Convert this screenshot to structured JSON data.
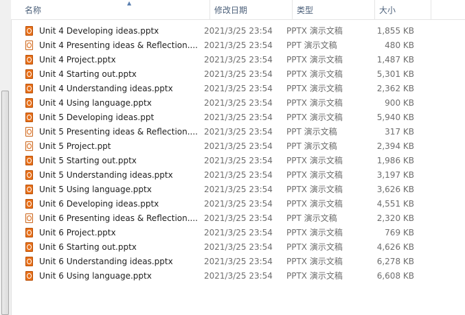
{
  "columns": {
    "name": "名称",
    "date": "修改日期",
    "type": "类型",
    "size": "大小"
  },
  "files": [
    {
      "name": "Unit 4 Developing ideas.pptx",
      "date": "2021/3/25 23:54",
      "type": "PPTX 演示文稿",
      "size": "1,855 KB",
      "icon": "pptx"
    },
    {
      "name": "Unit 4 Presenting ideas & Reflection....",
      "date": "2021/3/25 23:54",
      "type": "PPT 演示文稿",
      "size": "480 KB",
      "icon": "ppt"
    },
    {
      "name": "Unit 4 Project.pptx",
      "date": "2021/3/25 23:54",
      "type": "PPTX 演示文稿",
      "size": "1,487 KB",
      "icon": "pptx"
    },
    {
      "name": "Unit 4 Starting out.pptx",
      "date": "2021/3/25 23:54",
      "type": "PPTX 演示文稿",
      "size": "5,301 KB",
      "icon": "pptx"
    },
    {
      "name": "Unit 4 Understanding ideas.pptx",
      "date": "2021/3/25 23:54",
      "type": "PPTX 演示文稿",
      "size": "2,362 KB",
      "icon": "pptx"
    },
    {
      "name": "Unit 4 Using language.pptx",
      "date": "2021/3/25 23:54",
      "type": "PPTX 演示文稿",
      "size": "900 KB",
      "icon": "pptx"
    },
    {
      "name": "Unit 5 Developing ideas.ppt",
      "date": "2021/3/25 23:54",
      "type": "PPTX 演示文稿",
      "size": "5,940 KB",
      "icon": "pptx"
    },
    {
      "name": "Unit 5 Presenting ideas & Reflection....",
      "date": "2021/3/25 23:54",
      "type": "PPT 演示文稿",
      "size": "317 KB",
      "icon": "ppt"
    },
    {
      "name": "Unit 5 Project.ppt",
      "date": "2021/3/25 23:54",
      "type": "PPT 演示文稿",
      "size": "2,394 KB",
      "icon": "ppt"
    },
    {
      "name": "Unit 5 Starting out.pptx",
      "date": "2021/3/25 23:54",
      "type": "PPTX 演示文稿",
      "size": "1,986 KB",
      "icon": "pptx"
    },
    {
      "name": "Unit 5 Understanding ideas.pptx",
      "date": "2021/3/25 23:54",
      "type": "PPTX 演示文稿",
      "size": "3,197 KB",
      "icon": "pptx"
    },
    {
      "name": "Unit 5 Using language.pptx",
      "date": "2021/3/25 23:54",
      "type": "PPTX 演示文稿",
      "size": "3,626 KB",
      "icon": "pptx"
    },
    {
      "name": "Unit 6 Developing ideas.pptx",
      "date": "2021/3/25 23:54",
      "type": "PPTX 演示文稿",
      "size": "4,551 KB",
      "icon": "pptx"
    },
    {
      "name": "Unit 6 Presenting ideas & Reflection....",
      "date": "2021/3/25 23:54",
      "type": "PPT 演示文稿",
      "size": "2,320 KB",
      "icon": "ppt"
    },
    {
      "name": "Unit 6 Project.pptx",
      "date": "2021/3/25 23:54",
      "type": "PPTX 演示文稿",
      "size": "769 KB",
      "icon": "pptx"
    },
    {
      "name": "Unit 6 Starting out.pptx",
      "date": "2021/3/25 23:54",
      "type": "PPTX 演示文稿",
      "size": "4,626 KB",
      "icon": "pptx"
    },
    {
      "name": "Unit 6 Understanding ideas.pptx",
      "date": "2021/3/25 23:54",
      "type": "PPTX 演示文稿",
      "size": "6,278 KB",
      "icon": "pptx"
    },
    {
      "name": "Unit 6 Using language.pptx",
      "date": "2021/3/25 23:54",
      "type": "PPTX 演示文稿",
      "size": "6,608 KB",
      "icon": "pptx"
    }
  ]
}
